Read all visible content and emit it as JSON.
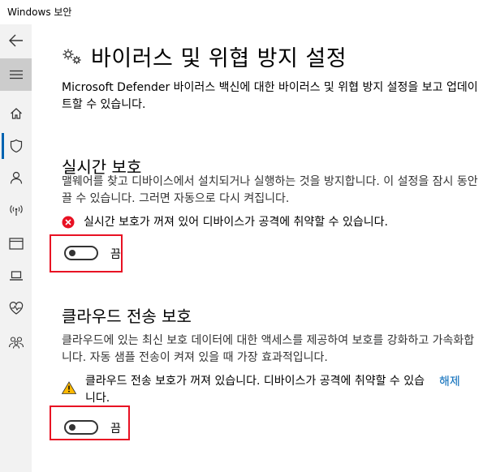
{
  "window": {
    "title": "Windows 보안"
  },
  "sidebar": {
    "items": [
      {
        "name": "back-arrow-icon"
      },
      {
        "name": "hamburger-menu-icon"
      },
      {
        "name": "home-icon"
      },
      {
        "name": "shield-icon",
        "active": true
      },
      {
        "name": "person-icon"
      },
      {
        "name": "wireless-icon"
      },
      {
        "name": "browser-window-icon"
      },
      {
        "name": "laptop-icon"
      },
      {
        "name": "heart-health-icon"
      },
      {
        "name": "family-icon"
      }
    ]
  },
  "page": {
    "title": "바이러스 및 위협 방지 설정",
    "description": "Microsoft Defender 바이러스 백신에 대한 바이러스 및 위협 방지 설정을 보고 업데이트할 수 있습니다."
  },
  "realtime": {
    "title": "실시간 보호",
    "description": "맬웨어를 찾고 디바이스에서 설치되거나 실행하는 것을 방지합니다. 이 설정을 잠시 동안 끌 수 있습니다. 그러면 자동으로 다시 켜집니다.",
    "warning": "실시간 보호가 꺼져 있어 디바이스가 공격에 취약할 수 있습니다.",
    "toggle_label": "끔",
    "toggle_on": false
  },
  "cloud": {
    "title": "클라우드 전송 보호",
    "description": "클라우드에 있는 최신 보호 데이터에 대한 액세스를 제공하여 보호를 강화하고 가속화합니다. 자동 샘플 전송이 켜져 있을 때 가장 효과적입니다.",
    "warning": "클라우드 전송 보호가 꺼져 있습니다. 디바이스가 공격에 취약할 수 있습니다.",
    "dismiss_label": "해제",
    "toggle_label": "끔",
    "toggle_on": false
  },
  "colors": {
    "accent": "#0063b1",
    "error": "#e81123",
    "warning": "#ffb900",
    "link": "#0067b8"
  }
}
